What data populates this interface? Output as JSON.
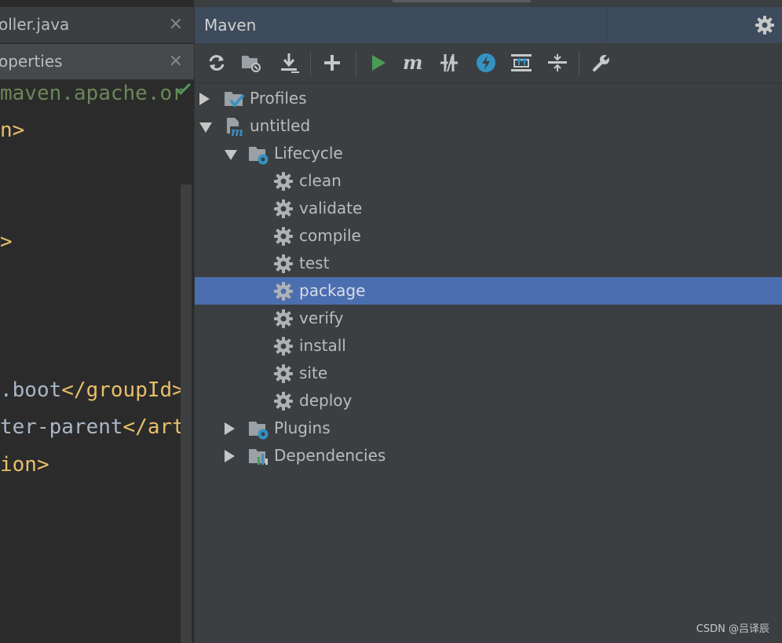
{
  "editor": {
    "tabs": [
      {
        "label": "oller.java",
        "close": "×"
      },
      {
        "label": "operties",
        "close": "×"
      }
    ],
    "code_lines": [
      {
        "text": "maven.apache.or",
        "kind": "str"
      },
      {
        "text": "n>",
        "kind": "tag"
      },
      {
        "text": ">",
        "kind": "tag"
      },
      {
        "text": ".boot",
        "kind": "txt",
        "tail": "</groupId>"
      },
      {
        "text": "ter-parent",
        "kind": "txt",
        "tail": "</art"
      },
      {
        "text": "ion>",
        "kind": "tag"
      }
    ]
  },
  "maven": {
    "title": "Maven",
    "toolbar": [
      {
        "name": "reload-icon",
        "label": ""
      },
      {
        "name": "generate-sources-icon",
        "label": ""
      },
      {
        "name": "download-icon",
        "label": ""
      },
      {
        "name": "add-icon",
        "label": ""
      },
      {
        "name": "run-icon",
        "label": ""
      },
      {
        "name": "execute-goal-icon",
        "label": ""
      },
      {
        "name": "toggle-offline-icon",
        "label": ""
      },
      {
        "name": "skip-tests-icon",
        "label": ""
      },
      {
        "name": "show-dependencies-icon",
        "label": ""
      },
      {
        "name": "collapse-all-icon",
        "label": ""
      },
      {
        "name": "settings-icon",
        "label": ""
      }
    ],
    "tree": {
      "profiles": "Profiles",
      "project": "untitled",
      "lifecycle": "Lifecycle",
      "goals": [
        "clean",
        "validate",
        "compile",
        "test",
        "package",
        "verify",
        "install",
        "site",
        "deploy"
      ],
      "selected_goal": "package",
      "plugins": "Plugins",
      "dependencies": "Dependencies"
    }
  },
  "watermark": "CSDN @吕译辰",
  "colors": {
    "selection": "#4b6eaf",
    "header": "#3d4b5c",
    "run_green": "#499c54",
    "icon_blue": "#3592c4"
  }
}
